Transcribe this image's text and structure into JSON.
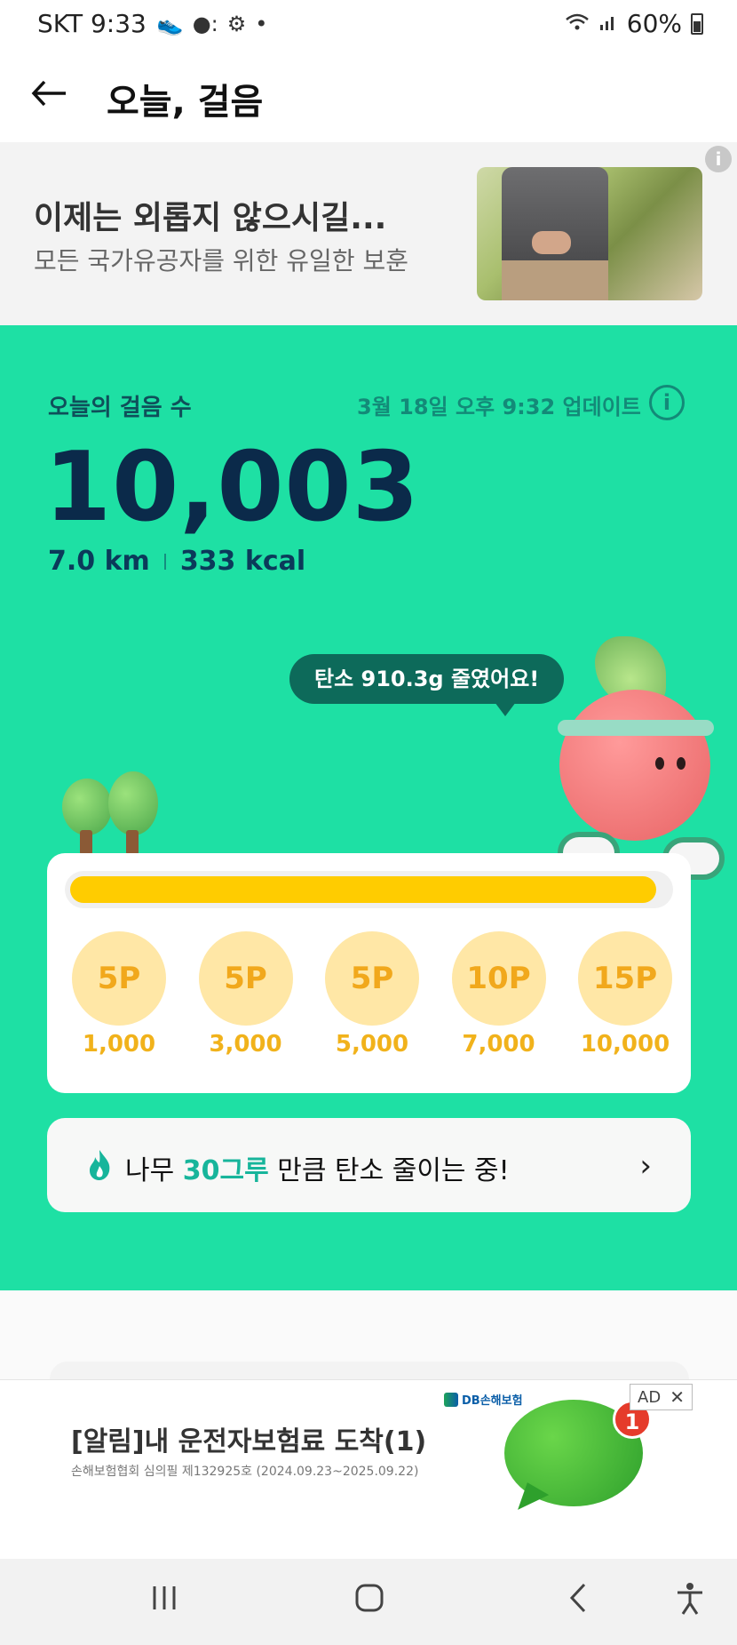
{
  "status_bar": {
    "carrier_time": "SKT 9:33",
    "battery": "60%"
  },
  "header": {
    "title": "오늘, 걸음"
  },
  "banner_ad": {
    "title": "이제는 외롭지 않으시길...",
    "subtitle": "모든 국가유공자를 위한 유일한 보훈"
  },
  "steps": {
    "label": "오늘의 걸음 수",
    "updated": "3월 18일 오후 9:32 업데이트",
    "count": "10,003",
    "distance": "7.0 km",
    "calories": "333 kcal"
  },
  "carbon_bubble": "탄소 910.3g 줄였어요!",
  "progress": {
    "fraction": 0.98,
    "milestones": [
      {
        "points": "5P",
        "steps": "1,000"
      },
      {
        "points": "5P",
        "steps": "3,000"
      },
      {
        "points": "5P",
        "steps": "5,000"
      },
      {
        "points": "10P",
        "steps": "7,000"
      },
      {
        "points": "15P",
        "steps": "10,000"
      }
    ]
  },
  "carbon_row": {
    "prefix": "나무",
    "highlight": "30그루",
    "suffix": "만큼 탄소 줄이는 중!"
  },
  "bottom_ad": {
    "tag": "AD",
    "title": "[알림]내 운전자보험료 도착(1)",
    "sub": "손해보험협회 심의필 제132925호 (2024.09.23~2025.09.22)",
    "brand": "DB손해보험",
    "badge": "1"
  },
  "colors": {
    "accent_green": "#1ee0a4",
    "progress_fill": "#ffcc00",
    "milestone_text": "#f1a81c",
    "highlight": "#17b59b"
  }
}
